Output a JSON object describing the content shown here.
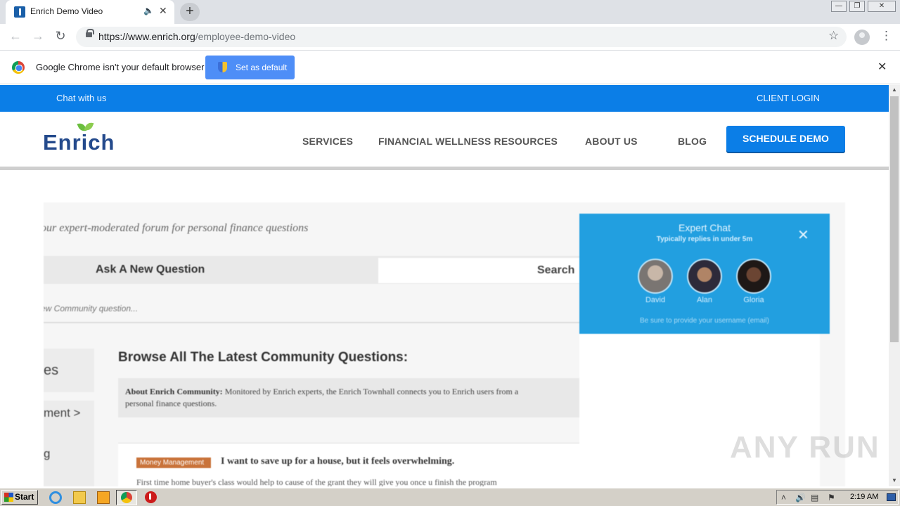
{
  "browser": {
    "tab": {
      "title": "Enrich Demo Video"
    },
    "address": {
      "host": "https://www.enrich.org",
      "path": "/employee-demo-video"
    },
    "infobar": {
      "message": "Google Chrome isn't your default browser",
      "button": "Set as default"
    }
  },
  "site": {
    "topbar": {
      "chat": "Chat with us",
      "login": "CLIENT LOGIN"
    },
    "logo": "Enrich",
    "nav": [
      "SERVICES",
      "FINANCIAL WELLNESS RESOURCES",
      "ABOUT US",
      "BLOG"
    ],
    "cta": "SCHEDULE DEMO"
  },
  "video": {
    "tagline": "our expert-moderated forum for personal finance questions",
    "ask": "Ask A New Question",
    "search": "Search",
    "new_question_hint": "ew Community question...",
    "side_items": [
      "es",
      "ment >",
      "g"
    ],
    "browse_title": "Browse All The Latest Community Questions:",
    "about_label": "About Enrich Community:",
    "about_text": "Monitored by Enrich experts, the Enrich Townhall connects you to Enrich users from a",
    "about_text_2": "personal finance questions.",
    "post": {
      "tag": "Money Management",
      "title": "I want to save up for a house, but it feels overwhelming.",
      "excerpt": "First time home buyer's class would help to cause of the grant they will give you once u finish the program"
    },
    "chat": {
      "title": "Expert Chat",
      "subtitle": "Typically replies in under 5m",
      "agents": [
        "David",
        "Alan",
        "Gloria"
      ],
      "note": "Be sure to provide your username (email)"
    }
  },
  "watermark": "ANY RUN",
  "taskbar": {
    "start": "Start",
    "clock": "2:19 AM"
  },
  "colors": {
    "brand_blue": "#0b7ee7",
    "chat_blue": "#229fe0",
    "logo_navy": "#244a8c",
    "leaf_green": "#6abe3e"
  }
}
